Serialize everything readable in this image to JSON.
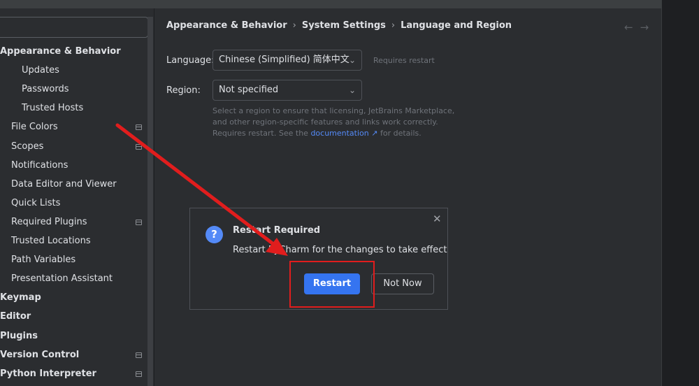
{
  "sidebar": {
    "search_value": "",
    "items": [
      {
        "label": "Appearance & Behavior",
        "level": 0,
        "bold": true
      },
      {
        "label": "Updates",
        "level": 2
      },
      {
        "label": "Passwords",
        "level": 2
      },
      {
        "label": "Trusted Hosts",
        "level": 2
      },
      {
        "label": "File Colors",
        "level": 1,
        "icon": true
      },
      {
        "label": "Scopes",
        "level": 1,
        "icon": true
      },
      {
        "label": "Notifications",
        "level": 1
      },
      {
        "label": "Data Editor and Viewer",
        "level": 1
      },
      {
        "label": "Quick Lists",
        "level": 1
      },
      {
        "label": "Required Plugins",
        "level": 1,
        "icon": true
      },
      {
        "label": "Trusted Locations",
        "level": 1
      },
      {
        "label": "Path Variables",
        "level": 1
      },
      {
        "label": "Presentation Assistant",
        "level": 1
      },
      {
        "label": "Keymap",
        "level": 0,
        "bold": true
      },
      {
        "label": "Editor",
        "level": 0,
        "bold": true
      },
      {
        "label": "Plugins",
        "level": 0,
        "bold": true
      },
      {
        "label": "Version Control",
        "level": 0,
        "bold": true,
        "icon": true
      },
      {
        "label": "Python Interpreter",
        "level": 0,
        "bold": true,
        "icon": true
      }
    ]
  },
  "breadcrumb": {
    "part1": "Appearance & Behavior",
    "part2": "System Settings",
    "part3": "Language and Region",
    "separator": "›"
  },
  "nav": {
    "back": "←",
    "forward": "→"
  },
  "language": {
    "label": "Language:",
    "value": "Chinese (Simplified) 简体中文",
    "note": "Requires restart"
  },
  "region": {
    "label": "Region:",
    "value": "Not specified",
    "hint_before": "Select a region to ensure that licensing, JetBrains Marketplace, and other region-specific features and links work correctly. Requires restart. See the",
    "hint_link": "documentation ↗",
    "hint_after": "for details."
  },
  "dialog": {
    "icon": "?",
    "title": "Restart Required",
    "message": "Restart PyCharm for the changes to take effect",
    "restart_label": "Restart",
    "not_now_label": "Not Now",
    "close": "✕"
  },
  "colors": {
    "accent": "#3574f0",
    "annotation": "#e11d1d",
    "link": "#548af7"
  }
}
